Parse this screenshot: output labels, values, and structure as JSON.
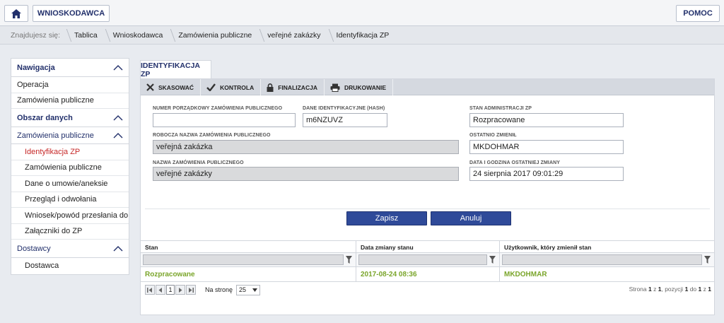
{
  "header": {
    "home_icon": "home-icon",
    "role_label": "WNIOSKODAWCA",
    "help_label": "POMOC"
  },
  "breadcrumb": {
    "prefix": "Znajdujesz się:",
    "items": [
      "Tablica",
      "Wnioskodawca",
      "Zamówienia publiczne",
      "veřejné zakázky",
      "Identyfikacja ZP"
    ]
  },
  "nav": {
    "section1": "Nawigacja",
    "items1": [
      "Operacja",
      "Zamówienia publiczne"
    ],
    "section2": "Obszar danych",
    "sub_section": "Zamówienia publiczne",
    "sub_items": [
      "Identyfikacja ZP",
      "Zamówienia publiczne",
      "Dane o umowie/aneksie",
      "Przegląd i odwołania",
      "Wniosek/powód przesłania do UOI",
      "Załączniki do ZP"
    ],
    "section3": "Dostawcy",
    "items3": [
      "Dostawca"
    ]
  },
  "tab": {
    "label": "IDENTYFIKACJA ZP"
  },
  "toolbar": {
    "delete": "SKASOWAĆ",
    "check": "KONTROLA",
    "finalize": "FINALIZACJA",
    "print": "DRUKOWANIE"
  },
  "form": {
    "order_number_label": "NUMER PORZĄDKOWY ZAMÓWIENIA PUBLICZNEGO",
    "order_number_value": "",
    "hash_label": "DANE IDENTYFIKACYJNE (HASH)",
    "hash_value": "m6NZUVZ",
    "admin_state_label": "STAN ADMINISTRACJI ZP",
    "admin_state_value": "Rozpracowane",
    "working_name_label": "ROBOCZA NAZWA ZAMÓWIENIA PUBLICZNEGO",
    "working_name_value": "veřejná zakázka",
    "last_changed_label": "OSTATNIO ZMIENIŁ",
    "last_changed_value": "MKDOHMAR",
    "name_label": "NAZWA ZAMÓWIENIA PUBLICZNEGO",
    "name_value": "veřejné zakázky",
    "last_change_date_label": "DATA I GODZINA OSTATNIEJ ZMIANY",
    "last_change_date_value": "24 sierpnia 2017 09:01:29",
    "save_label": "Zapisz",
    "cancel_label": "Anuluj"
  },
  "grid": {
    "columns": [
      "Stan",
      "Data zmiany stanu",
      "Użytkownik, który zmienił stan"
    ],
    "rows": [
      [
        "Rozpracowane",
        "2017-08-24 08:36",
        "MKDOHMAR"
      ]
    ],
    "status_color": "#7aa52a",
    "pager": {
      "current_page": "1",
      "per_page_label": "Na stronę",
      "per_page_value": "25",
      "info_prefix": "Strona",
      "page": "1",
      "of_label": "z",
      "total_pages": "1",
      "items_label": ", pozycji",
      "from": "1",
      "to_label": "do",
      "to": "1",
      "total_label": "z",
      "total": "1"
    }
  },
  "colors": {
    "accent": "#2f4a99",
    "active_nav": "#c62828",
    "nav_heading": "#22306b"
  }
}
